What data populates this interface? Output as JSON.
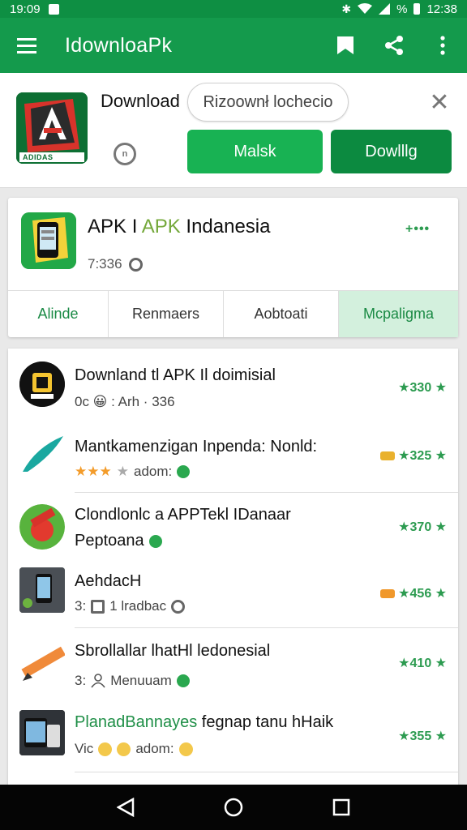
{
  "status_bar": {
    "time_left": "19:09",
    "battery": "%",
    "time_right": "12:38",
    "icons": [
      "sim-icon",
      "bluetooth-icon",
      "wifi-icon",
      "signal-icon"
    ]
  },
  "app_bar": {
    "title": "IdownloaPk",
    "icons": [
      "menu-icon",
      "bookmark-icon",
      "share-icon",
      "overflow-menu-icon"
    ]
  },
  "promo": {
    "title": "Download",
    "search_text": "Rizoownł lochecio",
    "more_button": "Malsk",
    "download_button": "Dowlllg",
    "logo_text": "ADIDAS"
  },
  "app_card": {
    "title_part1": "APK I ",
    "title_highlight": "APK",
    "title_part2": " Indanesia",
    "meta": "7:336",
    "rating": "+•••",
    "tabs": [
      {
        "label": "Alinde"
      },
      {
        "label": "Renmaers"
      },
      {
        "label": "Aobtoati"
      },
      {
        "label": "Mcpaligma"
      }
    ]
  },
  "list": {
    "items": [
      {
        "title": "Downland tl APK Il doimisial",
        "sub": "0c 😀 : Arh · 336",
        "rating": "★330 ★",
        "icon": "apk-badge-icon"
      },
      {
        "title": "Mantkamenzigan Inpenda: Nonld:",
        "sub": "adom:",
        "rating": "★325 ★",
        "icon": "feather-icon"
      },
      {
        "title": "Clondlonlc a APPTekl IDanaar",
        "sub": "Peptoana",
        "rating": "★370 ★",
        "icon": "fruit-app-icon"
      },
      {
        "title": "AehdacH",
        "sub": "1 lradbac",
        "sub_prefix": "3:",
        "rating": "★456 ★",
        "icon": "phone-screenshot-icon"
      },
      {
        "title": "Sbrollallar lhatHl ledonesial",
        "sub": "Menuuam",
        "sub_prefix": "3:",
        "rating": "★410 ★",
        "icon": "pencil-icon"
      },
      {
        "title": "PlanadBannayes",
        "title_rest": " fegnap tanu hHaik",
        "sub": "adom:",
        "sub_prefix": "Vic",
        "rating": "★355 ★",
        "icon": "devices-icon"
      }
    ]
  },
  "nav_bar": {
    "icons": [
      "back-icon",
      "home-icon",
      "recents-icon"
    ]
  }
}
